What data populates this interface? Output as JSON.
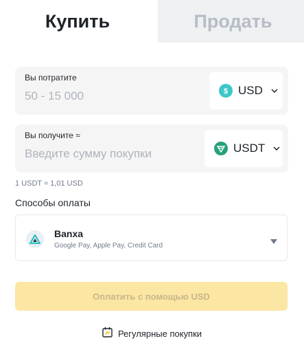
{
  "tabs": {
    "buy_label": "Купить",
    "sell_label": "Продать"
  },
  "spend": {
    "label": "Вы потратите",
    "placeholder": "50 - 15 000",
    "currency": "USD",
    "currency_icon": "dollar-coin-icon",
    "currency_color": "#3cc8c8"
  },
  "receive": {
    "label": "Вы получите ≈",
    "placeholder": "Введите сумму покупки",
    "currency": "USDT",
    "currency_icon": "tether-icon",
    "currency_color": "#26a17b"
  },
  "rate_text": "1 USDT ≈ 1,01 USD",
  "payment": {
    "title": "Способы оплаты",
    "provider_name": "Banxa",
    "provider_methods": "Google Pay, Apple Pay, Credit Card",
    "provider_icon": "banxa-logo-icon"
  },
  "pay_button_label": "Оплатить с помощью USD",
  "recurring_label": "Регулярные покупки",
  "colors": {
    "brand_yellow_disabled": "#fbe6a3",
    "tab_inactive_bg": "#eef0f2",
    "field_bg": "#f5f5f5"
  }
}
